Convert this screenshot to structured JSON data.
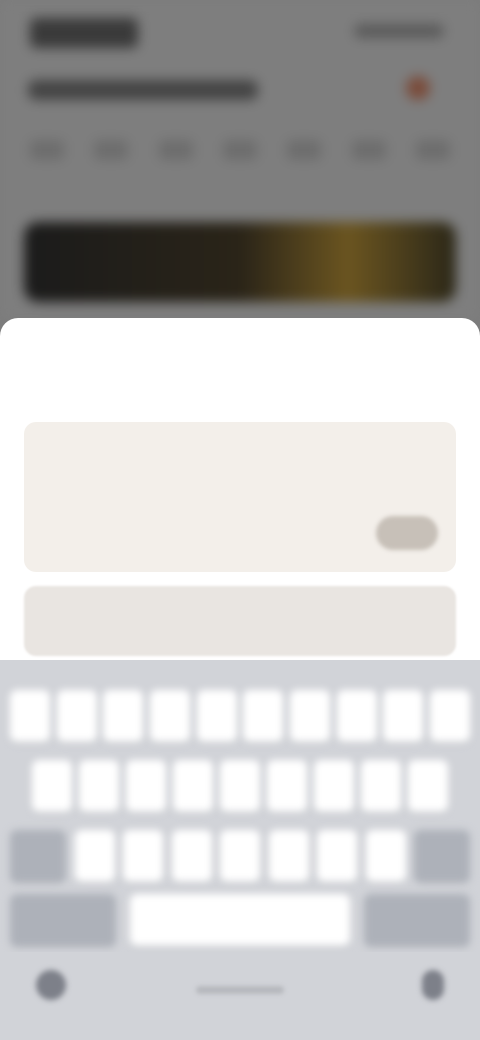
{
  "sheet": {
    "title": "",
    "comment_placeholder": "",
    "send_label": ""
  },
  "keyboard": {
    "row1": [
      "",
      "",
      "",
      "",
      "",
      "",
      "",
      "",
      "",
      ""
    ],
    "row2": [
      "",
      "",
      "",
      "",
      "",
      "",
      "",
      "",
      ""
    ],
    "row3": [
      "",
      "",
      "",
      "",
      "",
      "",
      "",
      "",
      ""
    ],
    "row4": [
      "",
      "",
      ""
    ]
  },
  "icons": {
    "globe": "globe-icon",
    "mic": "microphone-icon"
  }
}
